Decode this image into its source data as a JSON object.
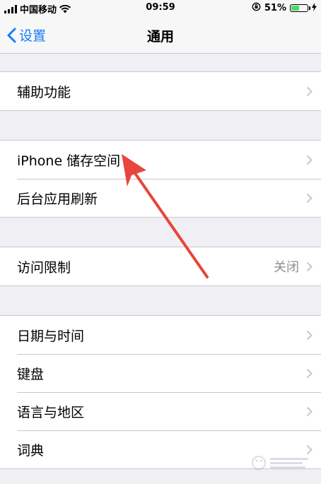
{
  "status_bar": {
    "carrier": "中国移动",
    "time": "09:59",
    "battery": "51%",
    "battery_level": 0.51
  },
  "nav": {
    "back_label": "设置",
    "title": "通用"
  },
  "groups": [
    {
      "items": [
        {
          "label": "辅助功能"
        }
      ]
    },
    {
      "items": [
        {
          "label": "iPhone 储存空间"
        },
        {
          "label": "后台应用刷新"
        }
      ]
    },
    {
      "items": [
        {
          "label": "访问限制",
          "value": "关闭"
        }
      ]
    },
    {
      "items": [
        {
          "label": "日期与时间"
        },
        {
          "label": "键盘"
        },
        {
          "label": "语言与地区"
        },
        {
          "label": "词典"
        }
      ]
    }
  ],
  "colors": {
    "accent": "#147efb",
    "annotation": "#e8453c",
    "background": "#efeff4"
  }
}
